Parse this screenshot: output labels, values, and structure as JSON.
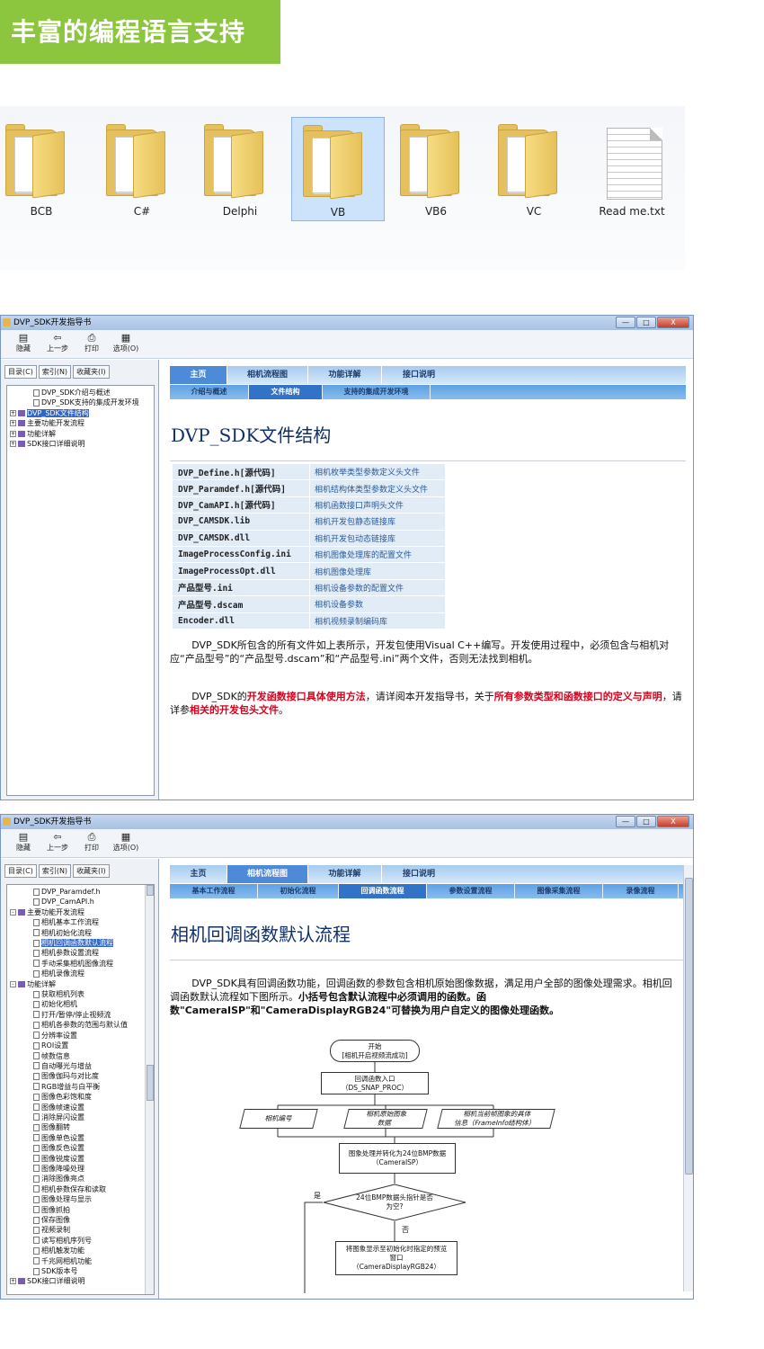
{
  "banner": {
    "title": "丰富的编程语言支持"
  },
  "explorer": {
    "items": [
      {
        "label": "BCB",
        "type": "folder",
        "selected": false
      },
      {
        "label": "C#",
        "type": "folder",
        "selected": false
      },
      {
        "label": "Delphi",
        "type": "folder",
        "selected": false
      },
      {
        "label": "VB",
        "type": "folder",
        "selected": true
      },
      {
        "label": "VB6",
        "type": "folder",
        "selected": false
      },
      {
        "label": "VC",
        "type": "folder",
        "selected": false
      },
      {
        "label": "Read me.txt",
        "type": "file",
        "selected": false
      }
    ]
  },
  "window1": {
    "title": "DVP_SDK开发指导书",
    "win_buttons": [
      "—",
      "□",
      "X"
    ],
    "toolbar": [
      {
        "icon": "hide-icon",
        "label": "隐藏"
      },
      {
        "icon": "back-icon",
        "label": "上一步"
      },
      {
        "icon": "print-icon",
        "label": "打印"
      },
      {
        "icon": "options-icon",
        "label": "选项(O)"
      }
    ],
    "left_tabs": [
      "目录(C)",
      "索引(N)",
      "收藏夹(I)"
    ],
    "tree": [
      {
        "label": "DVP_SDK介绍与概述",
        "type": "page",
        "expander": "",
        "level": 1
      },
      {
        "label": "DVP_SDK支持的集成开发环境",
        "type": "page",
        "expander": "",
        "level": 1
      },
      {
        "label": "DVP_SDK文件结构",
        "type": "book",
        "expander": "+",
        "level": 0,
        "selected": true
      },
      {
        "label": "主要功能开发流程",
        "type": "book",
        "expander": "+",
        "level": 0
      },
      {
        "label": "功能详解",
        "type": "book",
        "expander": "+",
        "level": 0
      },
      {
        "label": "SDK接口详细说明",
        "type": "book",
        "expander": "+",
        "level": 0
      }
    ],
    "nav": [
      "主页",
      "相机流程图",
      "功能详解",
      "接口说明"
    ],
    "subnav": [
      "介绍与概述",
      "文件结构",
      "支持的集成开发环境"
    ],
    "page_title": "DVP_SDK文件结构",
    "files": [
      {
        "name": "DVP_Define.h[源代码]",
        "desc": "相机枚举类型参数定义头文件"
      },
      {
        "name": "DVP_Paramdef.h[源代码]",
        "desc": "相机结构体类型参数定义头文件"
      },
      {
        "name": "DVP_CamAPI.h[源代码]",
        "desc": "相机函数接口声明头文件"
      },
      {
        "name": "DVP_CAMSDK.lib",
        "desc": "相机开发包静态链接库"
      },
      {
        "name": "DVP_CAMSDK.dll",
        "desc": "相机开发包动态链接库"
      },
      {
        "name": "ImageProcessConfig.ini",
        "desc": "相机图像处理库的配置文件"
      },
      {
        "name": "ImageProcessOpt.dll",
        "desc": "相机图像处理库"
      },
      {
        "name": "产品型号.ini",
        "desc": "相机设备参数的配置文件"
      },
      {
        "name": "产品型号.dscam",
        "desc": "相机设备参数"
      },
      {
        "name": "Encoder.dll",
        "desc": "相机视频录制编码库"
      }
    ],
    "para1": "DVP_SDK所包含的所有文件如上表所示，开发包使用Visual C++编写。开发使用过程中，必须包含与相机对应“产品型号”的“产品型号.dscam”和“产品型号.ini”两个文件，否则无法找到相机。",
    "para2": {
      "a": "DVP_SDK的",
      "b": "开发函数接口具体使用方法",
      "c": "，请详阅本开发指导书，关于",
      "d": "所有参数类型和函数接口的定义与声明",
      "e": "，请详参",
      "f": "相关的开发包头文件",
      "g": "。"
    }
  },
  "window2": {
    "title": "DVP_SDK开发指导书",
    "win_buttons": [
      "—",
      "□",
      "X"
    ],
    "toolbar": [
      {
        "icon": "hide-icon",
        "label": "隐藏"
      },
      {
        "icon": "back-icon",
        "label": "上一步"
      },
      {
        "icon": "print-icon",
        "label": "打印"
      },
      {
        "icon": "options-icon",
        "label": "选项(O)"
      }
    ],
    "left_tabs": [
      "目录(C)",
      "索引(N)",
      "收藏夹(I)"
    ],
    "tree": [
      {
        "label": "DVP_Paramdef.h",
        "type": "page",
        "expander": "",
        "level": 2
      },
      {
        "label": "DVP_CamAPI.h",
        "type": "page",
        "expander": "",
        "level": 2
      },
      {
        "label": "主要功能开发流程",
        "type": "book",
        "expander": "-",
        "level": 0
      },
      {
        "label": "相机基本工作流程",
        "type": "page",
        "expander": "",
        "level": 2
      },
      {
        "label": "相机初始化流程",
        "type": "page",
        "expander": "",
        "level": 2
      },
      {
        "label": "相机回调函数默认流程",
        "type": "page",
        "expander": "",
        "level": 2,
        "selected": true
      },
      {
        "label": "相机参数设置流程",
        "type": "page",
        "expander": "",
        "level": 2
      },
      {
        "label": "手动采集相机图像流程",
        "type": "page",
        "expander": "",
        "level": 2
      },
      {
        "label": "相机录像流程",
        "type": "page",
        "expander": "",
        "level": 2
      },
      {
        "label": "功能详解",
        "type": "book",
        "expander": "-",
        "level": 0
      },
      {
        "label": "获取相机列表",
        "type": "page",
        "expander": "",
        "level": 2
      },
      {
        "label": "初始化相机",
        "type": "page",
        "expander": "",
        "level": 2
      },
      {
        "label": "打开/暂停/停止视频流",
        "type": "page",
        "expander": "",
        "level": 2
      },
      {
        "label": "相机各参数的范围与默认值",
        "type": "page",
        "expander": "",
        "level": 2
      },
      {
        "label": "分辨率设置",
        "type": "page",
        "expander": "",
        "level": 2
      },
      {
        "label": "ROI设置",
        "type": "page",
        "expander": "",
        "level": 2
      },
      {
        "label": "帧数信息",
        "type": "page",
        "expander": "",
        "level": 2
      },
      {
        "label": "自动曝光与增益",
        "type": "page",
        "expander": "",
        "level": 2
      },
      {
        "label": "图像伽玛与对比度",
        "type": "page",
        "expander": "",
        "level": 2
      },
      {
        "label": "RGB增益与白平衡",
        "type": "page",
        "expander": "",
        "level": 2
      },
      {
        "label": "图像色彩饱和度",
        "type": "page",
        "expander": "",
        "level": 2
      },
      {
        "label": "图像帧速设置",
        "type": "page",
        "expander": "",
        "level": 2
      },
      {
        "label": "消除屏闪设置",
        "type": "page",
        "expander": "",
        "level": 2
      },
      {
        "label": "图像翻转",
        "type": "page",
        "expander": "",
        "level": 2
      },
      {
        "label": "图像单色设置",
        "type": "page",
        "expander": "",
        "level": 2
      },
      {
        "label": "图像反色设置",
        "type": "page",
        "expander": "",
        "level": 2
      },
      {
        "label": "图像锐度设置",
        "type": "page",
        "expander": "",
        "level": 2
      },
      {
        "label": "图像降噪处理",
        "type": "page",
        "expander": "",
        "level": 2
      },
      {
        "label": "消除图像亮点",
        "type": "page",
        "expander": "",
        "level": 2
      },
      {
        "label": "相机参数保存和读取",
        "type": "page",
        "expander": "",
        "level": 2
      },
      {
        "label": "图像处理与显示",
        "type": "page",
        "expander": "",
        "level": 2
      },
      {
        "label": "图像抓拍",
        "type": "page",
        "expander": "",
        "level": 2
      },
      {
        "label": "保存图像",
        "type": "page",
        "expander": "",
        "level": 2
      },
      {
        "label": "视频录制",
        "type": "page",
        "expander": "",
        "level": 2
      },
      {
        "label": "读写相机序列号",
        "type": "page",
        "expander": "",
        "level": 2
      },
      {
        "label": "相机触发功能",
        "type": "page",
        "expander": "",
        "level": 2
      },
      {
        "label": "千兆网相机功能",
        "type": "page",
        "expander": "",
        "level": 2
      },
      {
        "label": "SDK版本号",
        "type": "page",
        "expander": "",
        "level": 2
      },
      {
        "label": "SDK接口详细说明",
        "type": "book",
        "expander": "+",
        "level": 0
      }
    ],
    "nav": [
      "主页",
      "相机流程图",
      "功能详解",
      "接口说明"
    ],
    "subnav": [
      "基本工作流程",
      "初始化流程",
      "回调函数流程",
      "参数设置流程",
      "图像采集流程",
      "录像流程"
    ],
    "page_title": "相机回调函数默认流程",
    "para": {
      "a": "DVP_SDK具有回调函数功能，回调函数的参数包含相机原始图像数据，满足用户全部的图像处理需求。相机回调函数默认流程如下图所示。",
      "b": "小括号包含默认流程中必须调用的函数。函数\"CameraISP\"和\"CameraDisplayRGB24\"可替换为用户自定义的图像处理函数。"
    },
    "flow": {
      "start": "开始\n[相机开启视频流成功]",
      "entry": "回调函数入口\n（DS_SNAP_PROC）",
      "p1": "相机编号",
      "p2": "相机原始图象\n数据",
      "p3": "相机当前帧图象的具体\n信息（FrameInfo结构体）",
      "isp": "图象处理并转化为24位BMP数据\n（CameraISP）",
      "decision": "24位BMP数据头指针是否\n为空?",
      "yes": "是",
      "no": "否",
      "display": "将图象显示至初始化时指定的预览\n窗口\n（CameraDisplayRGB24）"
    }
  },
  "colors": {
    "banner": "#8cc63e",
    "nav_active": "#4d8ad8",
    "highlight_red": "#d9001b"
  }
}
